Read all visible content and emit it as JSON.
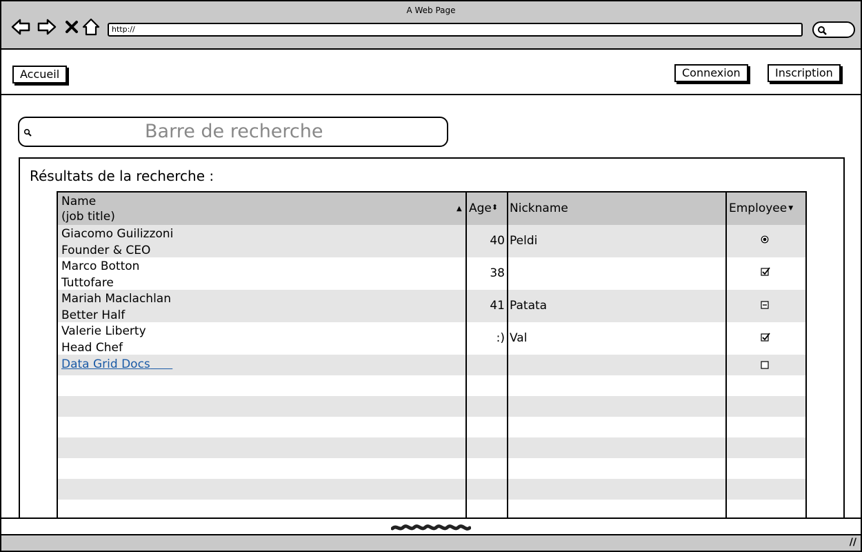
{
  "browser": {
    "title": "A Web Page",
    "url": "http://"
  },
  "nav": {
    "home": "Accueil",
    "login": "Connexion",
    "signup": "Inscription"
  },
  "search": {
    "placeholder": "Barre de recherche"
  },
  "results": {
    "title": "Résultats de la recherche :",
    "columns": {
      "name_line1": "Name",
      "name_line2": "(job title)",
      "age": "Age",
      "nickname": "Nickname",
      "employee": "Employee"
    },
    "rows": [
      {
        "name": "Giacomo Guilizzoni",
        "job": "Founder & CEO",
        "age": "40",
        "nickname": "Peldi",
        "employee": "radio-selected"
      },
      {
        "name": "Marco Botton",
        "job": "Tuttofare",
        "age": "38",
        "nickname": "",
        "employee": "checked"
      },
      {
        "name": "Mariah Maclachlan",
        "job": "Better Half",
        "age": "41",
        "nickname": "Patata",
        "employee": "indeterminate"
      },
      {
        "name": "Valerie Liberty",
        "job": "Head Chef",
        "age": ":)",
        "nickname": "Val",
        "employee": "checked"
      }
    ],
    "link": "Data Grid Docs"
  }
}
